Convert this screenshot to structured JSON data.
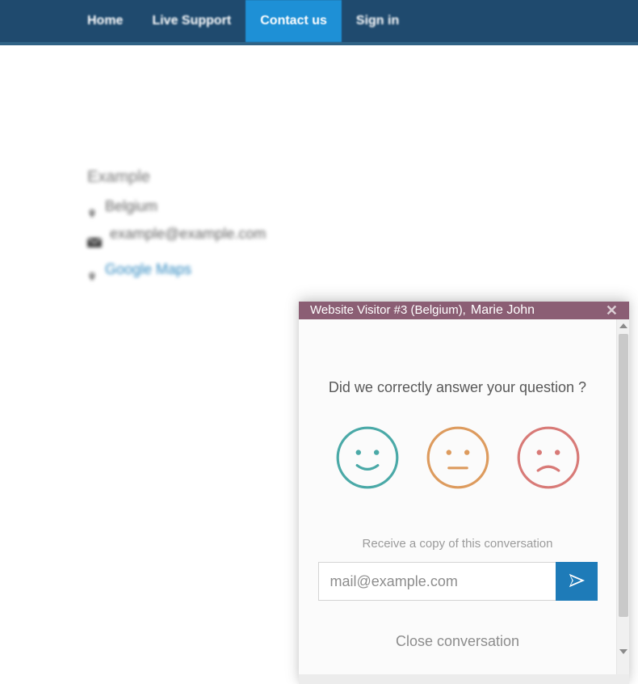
{
  "nav": {
    "items": [
      "Home",
      "Live Support",
      "Contact us",
      "Sign in"
    ],
    "active_index": 2
  },
  "contact": {
    "title": "Example",
    "location": "Belgium",
    "email": "example@example.com",
    "maps_label": "Google Maps"
  },
  "chat": {
    "header": {
      "visitor_label": "Website Visitor #3 (Belgium),",
      "agent_name": "Marie John"
    },
    "question": "Did we correctly answer your question ?",
    "faces": {
      "happy_color": "#4aa9a7",
      "neutral_color": "#dd9b5e",
      "sad_color": "#d87a77"
    },
    "copy_label": "Receive a copy of this conversation",
    "email_placeholder": "mail@example.com",
    "close_label": "Close conversation"
  }
}
